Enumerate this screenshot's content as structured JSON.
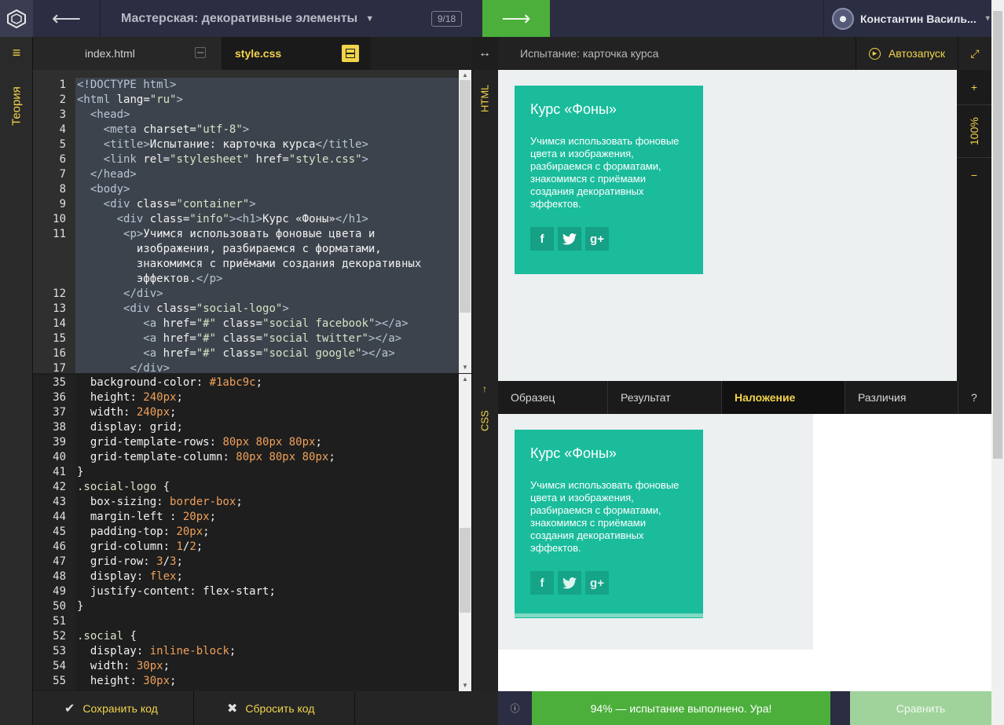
{
  "topbar": {
    "back_arrow": "⟵",
    "course_title": "Мастерская: декоративные элементы",
    "chevron": "⌄",
    "counter": "9/18",
    "next_arrow": "⟶",
    "user_name": "Константин Василь...",
    "user_chevron": "▾"
  },
  "rail": {
    "menu_icon": "≡",
    "theory_label": "Теория"
  },
  "tabs": [
    {
      "label": "index.html",
      "active": false
    },
    {
      "label": "style.css",
      "active": true
    }
  ],
  "html_code": {
    "line_numbers": [
      "1",
      "2",
      "3",
      "4",
      "5",
      "6",
      "7",
      "8",
      "9",
      "10",
      "11",
      "",
      "",
      "",
      "12",
      "13",
      "14",
      "15",
      "16",
      "17"
    ]
  },
  "css_code": {
    "line_numbers": [
      "35",
      "36",
      "37",
      "38",
      "39",
      "40",
      "41",
      "42",
      "43",
      "44",
      "45",
      "46",
      "47",
      "48",
      "49",
      "50",
      "51",
      "52",
      "53",
      "54",
      "55"
    ]
  },
  "side_labels": {
    "html": "HTML",
    "css": "CSS",
    "up_arrow": "↑"
  },
  "divider_icon": "↔",
  "preview": {
    "title": "Испытание: карточка курса",
    "autorun_label": "Автозапуск",
    "expand_icon": "⤢",
    "zoom_in": "+",
    "zoom_value": "100%",
    "zoom_out": "−"
  },
  "card": {
    "heading": "Курс «Фоны»",
    "text": "Учимся использовать фоновые цвета и изображения, разбираемся с форматами, знакомимся с приёмами создания декоративных эффектов.",
    "socials": [
      "f",
      "🐦",
      "g+"
    ]
  },
  "modes": [
    {
      "label": "Образец",
      "active": false
    },
    {
      "label": "Результат",
      "active": false
    },
    {
      "label": "Наложение",
      "active": true
    },
    {
      "label": "Различия",
      "active": false
    },
    {
      "label": "?",
      "active": false
    }
  ],
  "bottom": {
    "save_label": "Сохранить код",
    "save_icon": "✔",
    "reset_label": "Сбросить код",
    "reset_icon": "✖",
    "info_icon": "ⓘ",
    "status": "94% — испытание выполнено. Ура!",
    "compare_label": "Сравнить"
  },
  "colors": {
    "accent": "#f1d44a",
    "success": "#4caf3c",
    "card_bg": "#1abc9c"
  }
}
